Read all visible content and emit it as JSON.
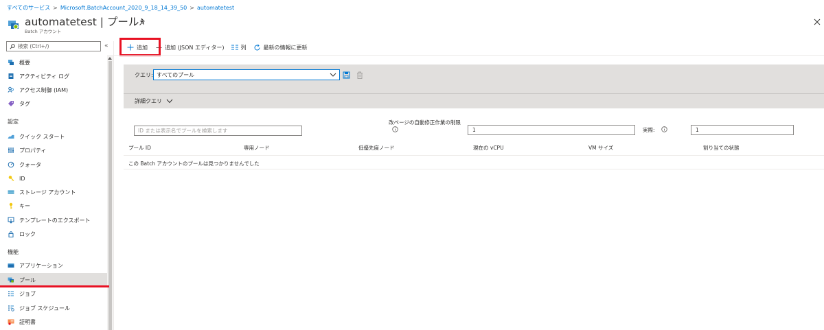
{
  "breadcrumb": [
    "すべてのサービス",
    "Microsoft.BatchAccount_2020_9_18_14_39_50",
    "automatetest"
  ],
  "header": {
    "title": "automatetest | プール",
    "subtitle": "Batch アカウント"
  },
  "sidebar": {
    "search_placeholder": "検索 (Ctrl+/)",
    "collapse_glyph": "«",
    "items_top": [
      {
        "label": "概要",
        "icon": "overview-icon"
      },
      {
        "label": "アクティビティ ログ",
        "icon": "activity-log-icon"
      },
      {
        "label": "アクセス制御 (IAM)",
        "icon": "iam-icon"
      },
      {
        "label": "タグ",
        "icon": "tag-icon"
      }
    ],
    "section_settings": "設定",
    "items_settings": [
      {
        "label": "クイック スタート",
        "icon": "quickstart-icon"
      },
      {
        "label": "プロパティ",
        "icon": "properties-icon"
      },
      {
        "label": "クォータ",
        "icon": "quota-icon"
      },
      {
        "label": "ID",
        "icon": "identity-icon"
      },
      {
        "label": "ストレージ アカウント",
        "icon": "storage-icon"
      },
      {
        "label": "キー",
        "icon": "key-icon"
      },
      {
        "label": "テンプレートのエクスポート",
        "icon": "export-icon"
      },
      {
        "label": "ロック",
        "icon": "lock-icon"
      }
    ],
    "section_features": "機能",
    "items_features": [
      {
        "label": "アプリケーション",
        "icon": "application-icon"
      },
      {
        "label": "プール",
        "icon": "pool-icon",
        "active": true
      },
      {
        "label": "ジョブ",
        "icon": "job-icon"
      },
      {
        "label": "ジョブ スケジュール",
        "icon": "job-schedule-icon"
      },
      {
        "label": "証明書",
        "icon": "certificate-icon"
      }
    ]
  },
  "toolbar": {
    "add_label": "追加",
    "add_json_label": "追加 (JSON エディター)",
    "columns_label": "列",
    "refresh_label": "最新の情報に更新"
  },
  "query": {
    "label": "クエリ:",
    "selected": "すべてのプール",
    "advanced_label": "詳細クエリ"
  },
  "filters": {
    "search_placeholder": "ID または表示名でプールを検索します",
    "auto_repair_label": "改ページの自動修正作業の制限",
    "auto_repair_value": "1",
    "actual_label": "実際:",
    "actual_value": "1"
  },
  "table": {
    "columns": [
      "プール ID",
      "専用ノード",
      "低優先度ノード",
      "現在の vCPU",
      "VM サイズ",
      "割り当ての状態"
    ],
    "empty_message": "この Batch アカウントのプールは見つかりませんでした"
  },
  "colors": {
    "accent": "#0078d4",
    "highlight_red": "#e81123",
    "panel_gray": "#e1dfdd"
  }
}
